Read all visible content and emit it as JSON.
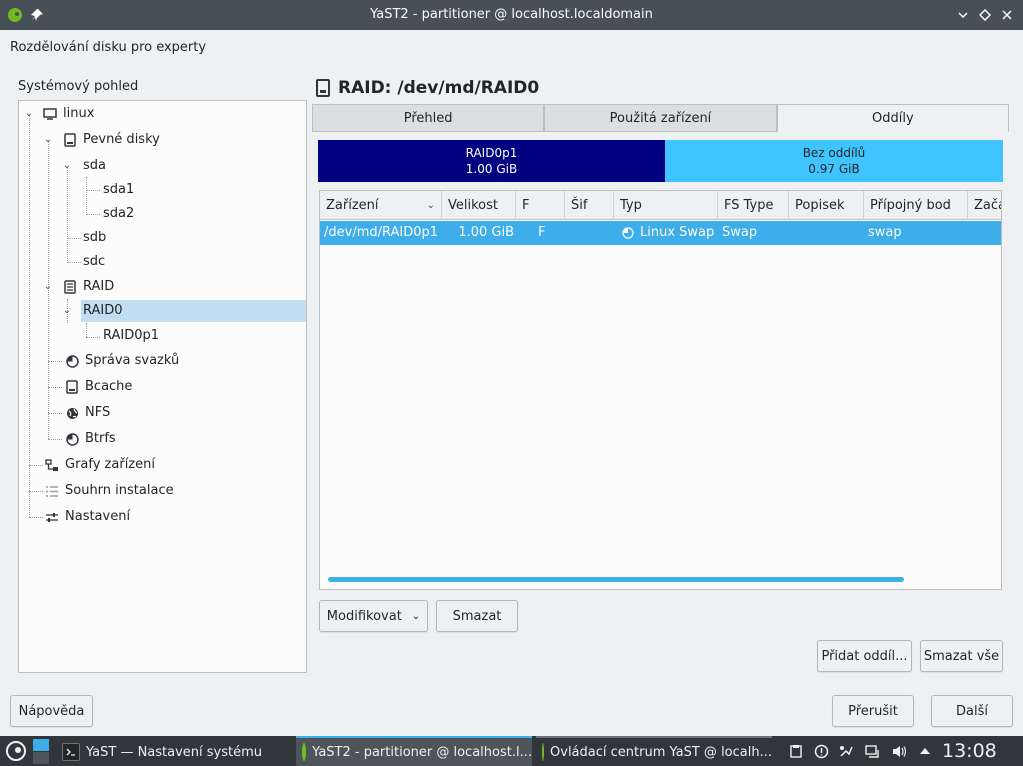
{
  "window": {
    "title": "YaST2 - partitioner @ localhost.localdomain",
    "subtitle": "Rozdělování disku pro experty"
  },
  "tree": {
    "label": "Systémový pohled",
    "items": {
      "linux": "linux",
      "pevne_disky": "Pevné disky",
      "sda": "sda",
      "sda1": "sda1",
      "sda2": "sda2",
      "sdb": "sdb",
      "sdc": "sdc",
      "raid": "RAID",
      "raid0": "RAID0",
      "raid0p1": "RAID0p1",
      "sprava_svazku": "Správa svazků",
      "bcache": "Bcache",
      "nfs": "NFS",
      "btrfs": "Btrfs",
      "grafy": "Grafy zařízení",
      "souhrn": "Souhrn instalace",
      "nastaveni": "Nastavení"
    },
    "selected": "RAID0"
  },
  "main": {
    "heading": "RAID: /dev/md/RAID0",
    "tabs": [
      "Přehled",
      "Použitá zařízení",
      "Oddíly"
    ],
    "active_tab": "Oddíly",
    "partition_bar": [
      {
        "name": "RAID0p1",
        "size": "1.00 GiB",
        "color": "#000080",
        "text_color": "#ffffff"
      },
      {
        "name": "Bez oddílů",
        "size": "0.97 GiB",
        "color": "#40c4ff",
        "text_color": "#232627"
      }
    ],
    "table": {
      "columns": [
        "Zařízení",
        "Velikost",
        "F",
        "Šif",
        "Typ",
        "FS Type",
        "Popisek",
        "Přípojný bod",
        "Začá"
      ],
      "rows": [
        {
          "device": "/dev/md/RAID0p1",
          "size": "1.00 GiB",
          "f": "F",
          "enc": "",
          "type": "Linux Swap",
          "fs": "Swap",
          "label": "",
          "mount": "swap",
          "start": ""
        }
      ]
    },
    "buttons": {
      "modify": "Modifikovat",
      "delete": "Smazat",
      "add_partition": "Přidat oddíl...",
      "delete_all": "Smazat vše"
    }
  },
  "footer": {
    "help": "Nápověda",
    "abort": "Přerušit",
    "next": "Další"
  },
  "taskbar": {
    "tasks": [
      {
        "label": "YaST  — Nastavení systému"
      },
      {
        "label": "YaST2 - partitioner @ localhost.l..."
      },
      {
        "label": "Ovládací centrum YaST @ localh..."
      }
    ],
    "clock": "13:08"
  },
  "colors": {
    "accent": "#3daee9",
    "titlebar": "#475057",
    "taskbar": "#31363b"
  }
}
